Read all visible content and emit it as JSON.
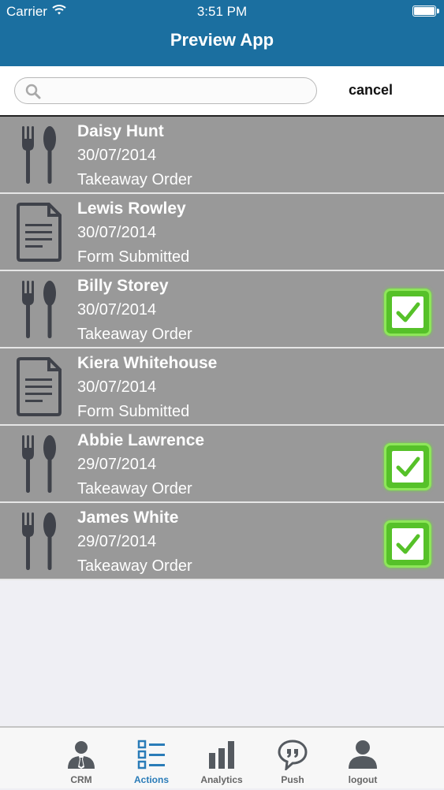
{
  "status_bar": {
    "carrier": "Carrier",
    "time": "3:51 PM"
  },
  "header": {
    "title": "Preview App"
  },
  "search": {
    "value": "",
    "placeholder": "",
    "cancel_label": "cancel"
  },
  "items": [
    {
      "name": "Daisy Hunt",
      "date": "30/07/2014",
      "type": "Takeaway Order",
      "icon": "cutlery-icon",
      "checked": false
    },
    {
      "name": "Lewis Rowley",
      "date": "30/07/2014",
      "type": "Form Submitted",
      "icon": "document-icon",
      "checked": false
    },
    {
      "name": "Billy Storey",
      "date": "30/07/2014",
      "type": "Takeaway Order",
      "icon": "cutlery-icon",
      "checked": true
    },
    {
      "name": "Kiera Whitehouse",
      "date": "30/07/2014",
      "type": "Form Submitted",
      "icon": "document-icon",
      "checked": false
    },
    {
      "name": "Abbie Lawrence",
      "date": "29/07/2014",
      "type": "Takeaway Order",
      "icon": "cutlery-icon",
      "checked": true
    },
    {
      "name": "James White",
      "date": "29/07/2014",
      "type": "Takeaway Order",
      "icon": "cutlery-icon",
      "checked": true
    }
  ],
  "tabs": [
    {
      "label": "CRM",
      "icon": "user-tie-icon",
      "active": false
    },
    {
      "label": "Actions",
      "icon": "checklist-icon",
      "active": true
    },
    {
      "label": "Analytics",
      "icon": "bar-chart-icon",
      "active": false
    },
    {
      "label": "Push",
      "icon": "speech-bubble-icon",
      "active": false
    },
    {
      "label": "logout",
      "icon": "user-icon",
      "active": false
    }
  ],
  "colors": {
    "header": "#1b6fa0",
    "row_background": "#999999",
    "check_green": "#56c129",
    "active_tab": "#2a7cb8",
    "icon_dark": "#3f424a"
  }
}
